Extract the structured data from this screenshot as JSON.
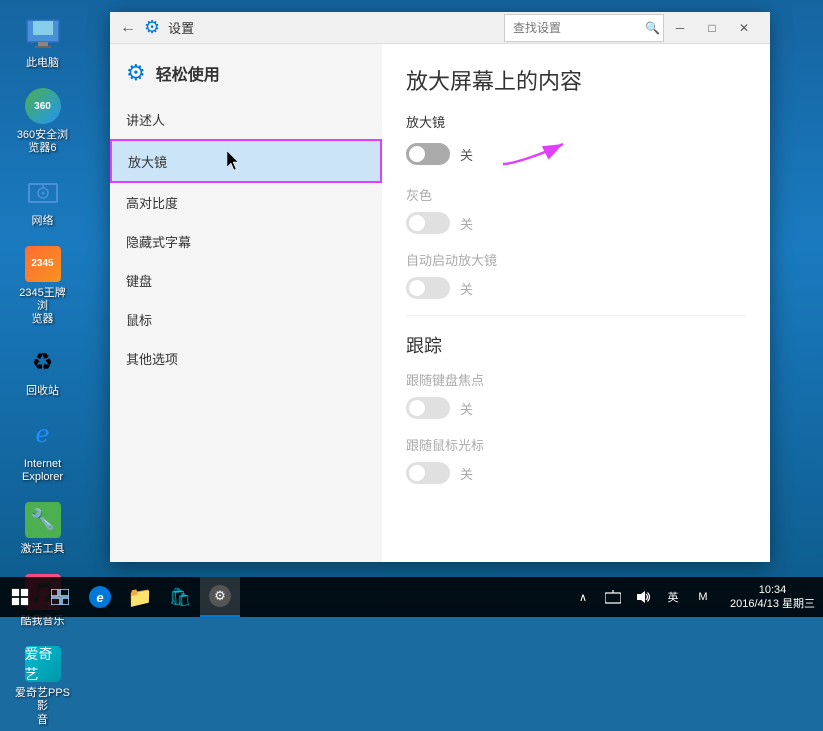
{
  "desktop": {
    "icons": [
      {
        "id": "computer",
        "label": "此电脑",
        "type": "computer"
      },
      {
        "id": "360",
        "label": "360安全浏\n览器6",
        "type": "360"
      },
      {
        "id": "network",
        "label": "网络",
        "type": "network"
      },
      {
        "id": "browser2345",
        "label": "2345王牌浏\n览器",
        "type": "browser"
      },
      {
        "id": "recycle",
        "label": "回收站",
        "type": "recycle"
      },
      {
        "id": "ie",
        "label": "Internet\nExplorer",
        "type": "ie"
      },
      {
        "id": "tools",
        "label": "激活工具",
        "type": "tools"
      },
      {
        "id": "music",
        "label": "酷我音乐",
        "type": "music"
      },
      {
        "id": "video",
        "label": "爱奇艺PPS 影\n音",
        "type": "video"
      }
    ]
  },
  "window": {
    "title": "设置",
    "back_label": "←",
    "minimize": "─",
    "maximize": "□",
    "close": "✕",
    "left_panel": {
      "title": "轻松使用",
      "search_placeholder": "查找设置",
      "nav_items": [
        {
          "id": "narrator",
          "label": "讲述人",
          "active": false
        },
        {
          "id": "magnifier",
          "label": "放大镜",
          "active": true
        },
        {
          "id": "contrast",
          "label": "高对比度",
          "active": false
        },
        {
          "id": "captions",
          "label": "隐藏式字幕",
          "active": false
        },
        {
          "id": "keyboard",
          "label": "键盘",
          "active": false
        },
        {
          "id": "mouse",
          "label": "鼠标",
          "active": false
        },
        {
          "id": "other",
          "label": "其他选项",
          "active": false
        }
      ]
    },
    "right_panel": {
      "section_title": "放大屏幕上的内容",
      "magnifier_label": "放大镜",
      "magnifier_toggle": "off",
      "magnifier_toggle_label": "关",
      "grayscale_label": "灰色",
      "grayscale_toggle": "off",
      "grayscale_toggle_label": "关",
      "grayscale_disabled": true,
      "auto_start_label": "自动启动放大镜",
      "auto_start_toggle": "off",
      "auto_start_toggle_label": "关",
      "auto_start_disabled": true,
      "tracking_section": "跟踪",
      "follow_keyboard_label": "跟随键盘焦点",
      "follow_keyboard_toggle": "off",
      "follow_keyboard_toggle_label": "关",
      "follow_keyboard_disabled": true,
      "follow_cursor_label": "跟随鼠标光标",
      "follow_cursor_toggle": "off",
      "follow_cursor_toggle_label": "关",
      "follow_cursor_disabled": true
    }
  },
  "taskbar": {
    "clock_time": "10:34",
    "clock_date": "2016/4/13 星期三",
    "tray": {
      "up_arrow": "∧",
      "monitor_icon": "▭",
      "volume_icon": "🔊",
      "lang": "英",
      "ime": "M"
    }
  }
}
